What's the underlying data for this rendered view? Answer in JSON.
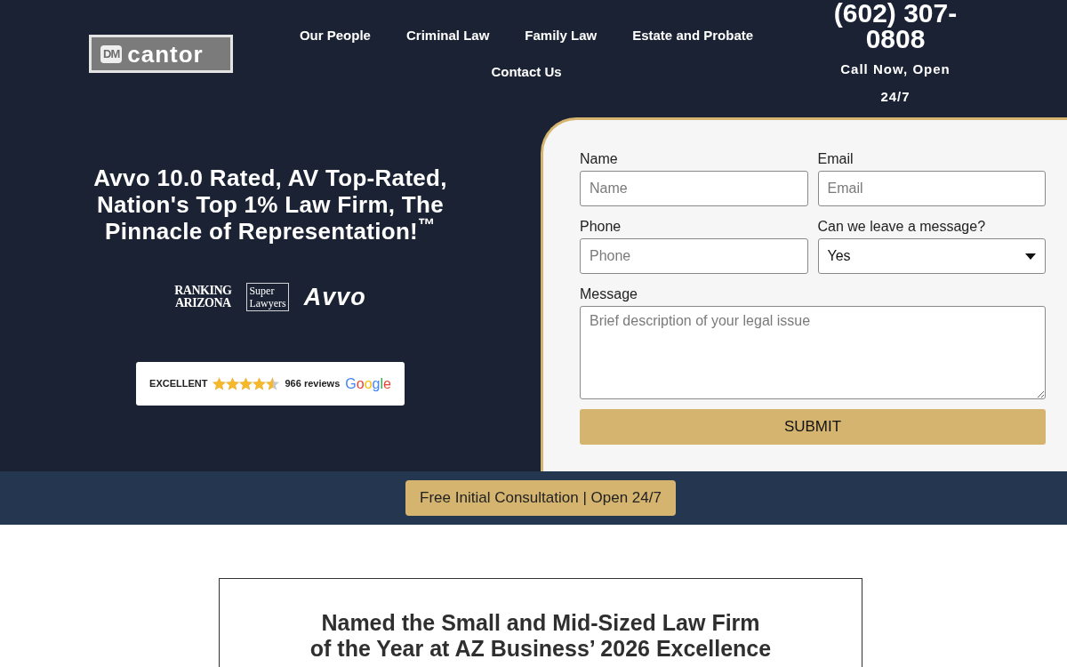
{
  "header": {
    "logo": {
      "mark": "DM",
      "wordmark": "cantor"
    },
    "nav": [
      {
        "label": "Our People"
      },
      {
        "label": "Criminal Law"
      },
      {
        "label": "Family Law"
      },
      {
        "label": "Estate and Probate"
      },
      {
        "label": "Contact Us"
      }
    ],
    "phone": "(602) 307-0808",
    "availability": "Call Now, Open 24/7"
  },
  "hero": {
    "headline": "Avvo 10.0 Rated, AV Top-Rated, Nation's Top 1% Law Firm, The Pinnacle of Representation!$^{™}$",
    "award_logos": [
      {
        "kind": "ranking_arizona",
        "text": "RANKING ARIZONA"
      },
      {
        "kind": "super_lawyers",
        "text": "Super Lawyers"
      },
      {
        "kind": "avvo",
        "text": "Avvo"
      }
    ],
    "review_badge": {
      "rating_label": "EXCELLENT",
      "stars": 4.5,
      "count": "966 reviews",
      "provider": "Google"
    }
  },
  "contact_form": {
    "fields": [
      {
        "kind": "text",
        "label": "Name",
        "placeholder": "Name"
      },
      {
        "kind": "text",
        "label": "Email",
        "placeholder": "Email"
      },
      {
        "kind": "text",
        "label": "Phone",
        "placeholder": "Phone"
      },
      {
        "kind": "select",
        "label": "Can we leave a message?",
        "value": "Yes"
      },
      {
        "kind": "textarea",
        "label": "Message",
        "placeholder": "Brief description of your legal issue"
      }
    ],
    "submit": "SUBMIT"
  },
  "cta_bar": {
    "button": "Free Initial Consultation | Open 24/7"
  },
  "award_section": {
    "heading": "Named the Small and Mid-Sized Law Firm of the Year at AZ Business’ 2026 Excellence"
  }
}
